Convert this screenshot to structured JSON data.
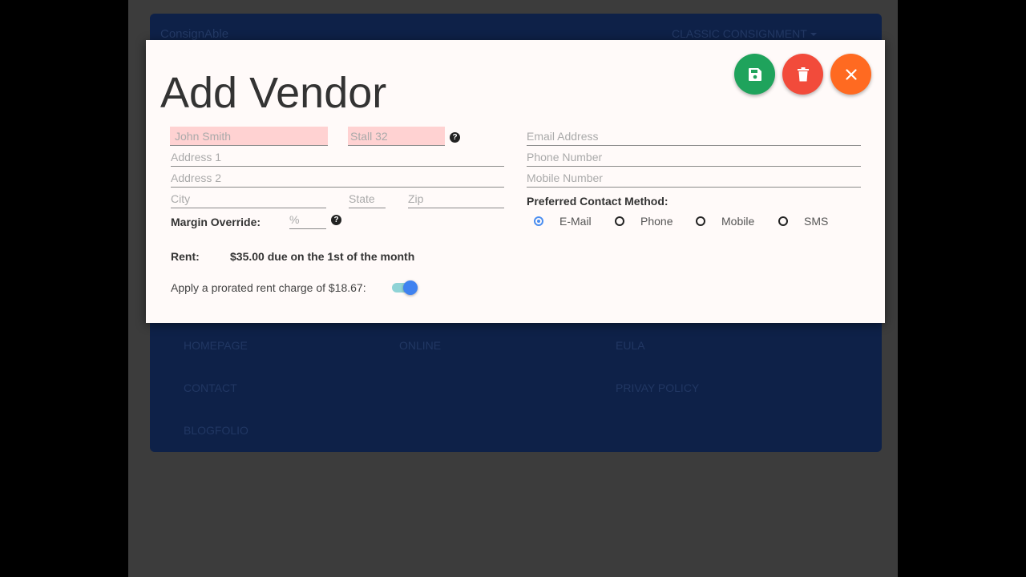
{
  "background_app": {
    "brand": "ConsignAble",
    "store_menu": "CLASSIC CONSIGNMENT",
    "footer_links": [
      {
        "label": "HOMEPAGE"
      },
      {
        "label": "ONLINE"
      },
      {
        "label": "EULA"
      },
      {
        "label": "CONTACT"
      },
      {
        "label": "PRIVAY POLICY"
      },
      {
        "label": "BLOGFOLIO"
      }
    ]
  },
  "modal": {
    "title": "Add Vendor",
    "actions": {
      "save": {
        "icon": "save-icon",
        "color": "#1fa35c"
      },
      "delete": {
        "icon": "trash-icon",
        "color": "#f24b3b"
      },
      "close": {
        "icon": "close-icon",
        "color": "#ff6a21"
      }
    },
    "fields": {
      "name": {
        "placeholder": "John Smith",
        "value": ""
      },
      "stall": {
        "placeholder": "Stall 32",
        "value": ""
      },
      "address1": {
        "placeholder": "Address 1",
        "value": ""
      },
      "address2": {
        "placeholder": "Address 2",
        "value": ""
      },
      "city": {
        "placeholder": "City",
        "value": ""
      },
      "state": {
        "placeholder": "State",
        "value": ""
      },
      "zip": {
        "placeholder": "Zip",
        "value": ""
      },
      "email": {
        "placeholder": "Email Address",
        "value": ""
      },
      "phone": {
        "placeholder": "Phone Number",
        "value": ""
      },
      "mobile": {
        "placeholder": "Mobile Number",
        "value": ""
      },
      "margin": {
        "placeholder": "%",
        "value": ""
      }
    },
    "help_glyph": "?",
    "margin_label": "Margin Override:",
    "contact_method": {
      "label": "Preferred Contact Method:",
      "options": [
        {
          "label": "E-Mail",
          "selected": true
        },
        {
          "label": "Phone",
          "selected": false
        },
        {
          "label": "Mobile",
          "selected": false
        },
        {
          "label": "SMS",
          "selected": false
        }
      ]
    },
    "rent": {
      "label": "Rent:",
      "value": "$35.00 due on the 1st of the month"
    },
    "prorate": {
      "label": "Apply a prorated rent charge of $18.67:",
      "enabled": true
    }
  }
}
